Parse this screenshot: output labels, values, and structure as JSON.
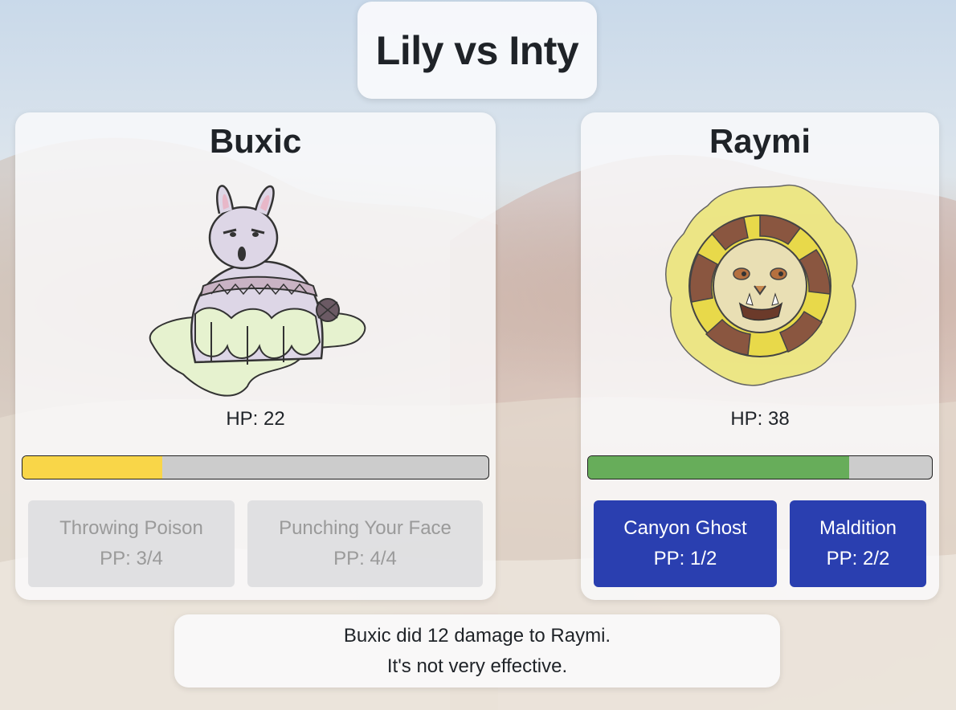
{
  "colors": {
    "hp_low": "#f9d648",
    "hp_high": "#67ad5a",
    "hp_empty": "#cccccc",
    "move_active": "#2a3fb0",
    "move_disabled": "#dcdcde"
  },
  "battle": {
    "title": "Lily vs Inty"
  },
  "player": {
    "name": "Buxic",
    "sprite_icon": "bunny-creature-drawing",
    "hp_label": "HP: 22",
    "hp_fraction": 0.3,
    "moves": [
      {
        "name": "Throwing Poison",
        "pp": "PP: 3/4",
        "enabled": false
      },
      {
        "name": "Punching Your Face",
        "pp": "PP: 4/4",
        "enabled": false
      }
    ]
  },
  "opponent": {
    "name": "Raymi",
    "sprite_icon": "sun-face-drawing",
    "hp_label": "HP: 38",
    "hp_fraction": 0.76,
    "moves": [
      {
        "name": "Canyon Ghost",
        "pp": "PP: 1/2",
        "enabled": true
      },
      {
        "name": "Maldition",
        "pp": "PP: 2/2",
        "enabled": true
      }
    ]
  },
  "log": {
    "lines": [
      "Buxic did 12 damage to Raymi.",
      "It's not very effective."
    ]
  }
}
